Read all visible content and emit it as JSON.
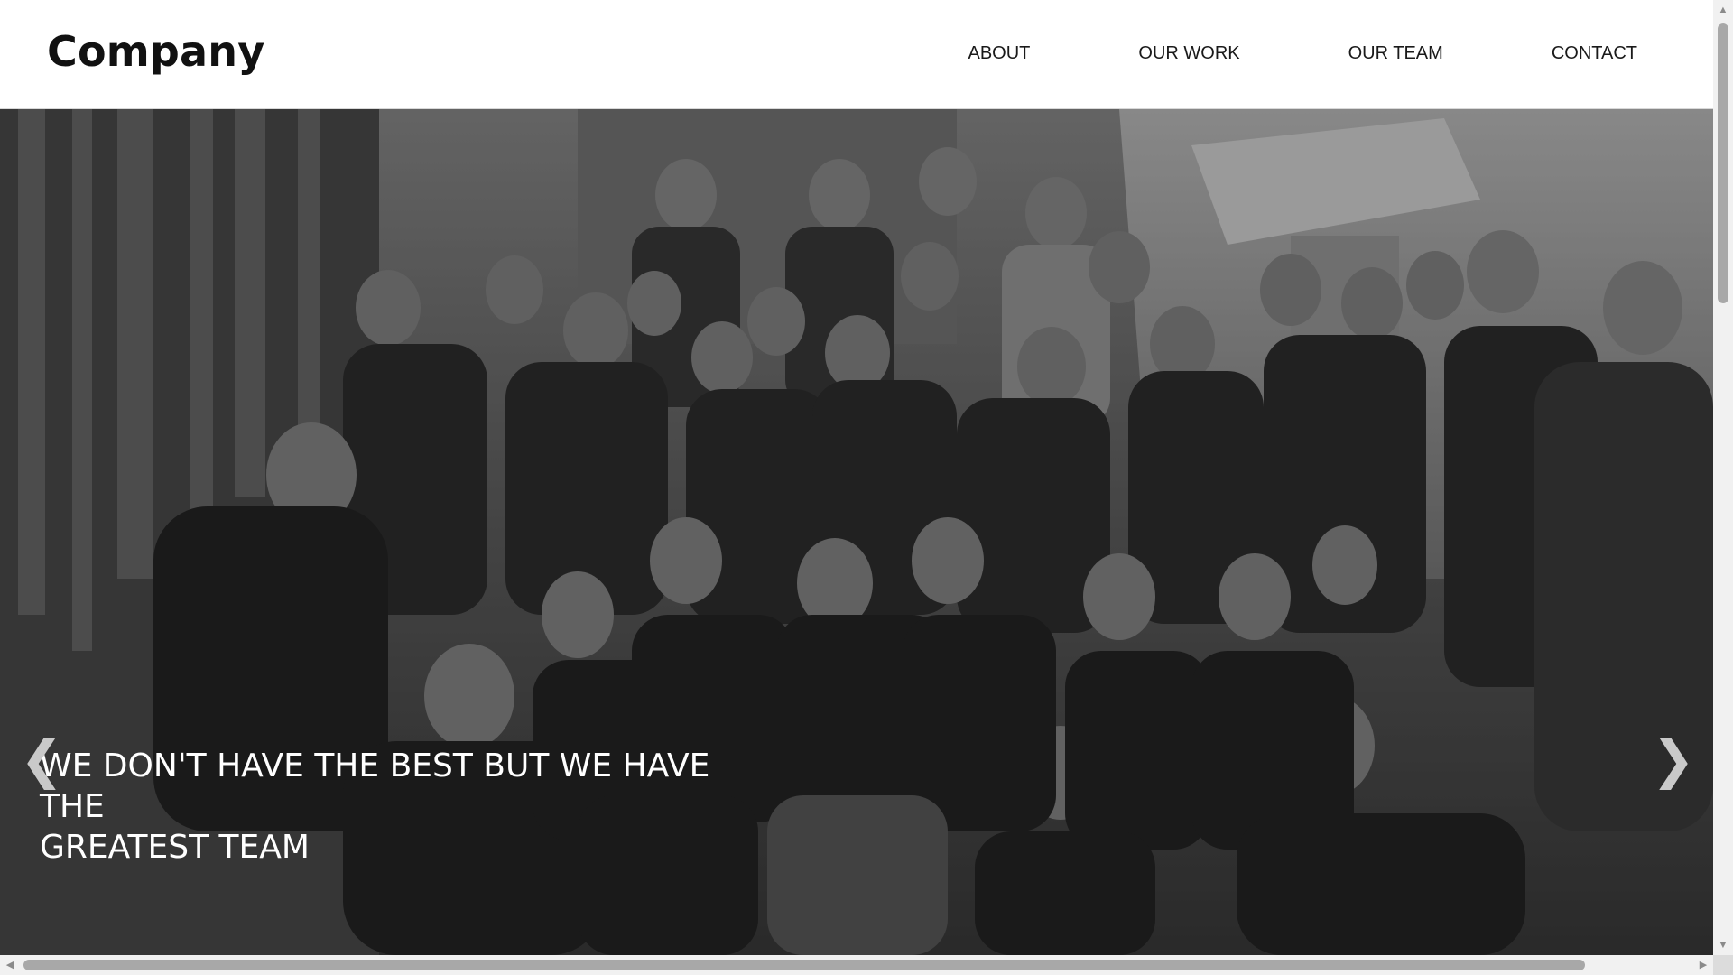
{
  "header": {
    "brand": "Company",
    "nav": [
      "ABOUT",
      "OUR WORK",
      "OUR TEAM",
      "CONTACT"
    ]
  },
  "hero": {
    "image": "grayscale group photo of a team",
    "caption_line1": "WE DON'T HAVE THE BEST BUT WE HAVE THE",
    "caption_line2": "GREATEST TEAM",
    "prev_glyph": "❮",
    "next_glyph": "❯"
  },
  "scrollbars": {
    "up": "▲",
    "down": "▼",
    "left": "◀",
    "right": "▶"
  }
}
